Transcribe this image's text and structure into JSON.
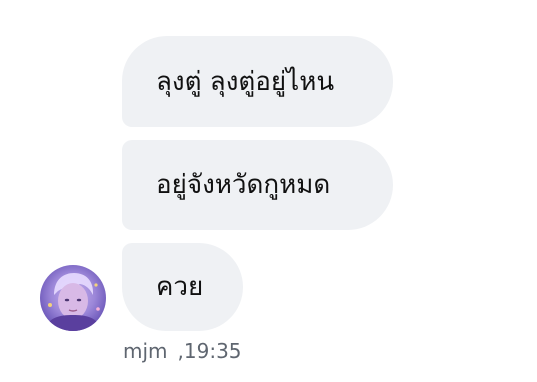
{
  "messages": [
    {
      "text": "ลุงตู่ ลุงตู่อยู่ไหน"
    },
    {
      "text": "อยู่จังหวัดกูหมด"
    },
    {
      "text": "ควย"
    }
  ],
  "meta": {
    "sender": "mjm",
    "time": ",19:35"
  },
  "avatar": {
    "icon": "user-avatar-photo"
  }
}
